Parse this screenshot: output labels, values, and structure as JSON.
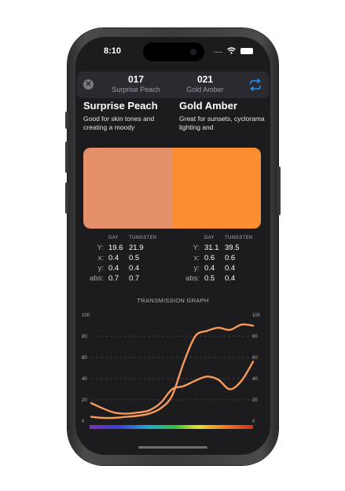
{
  "status_bar": {
    "time": "8:10",
    "dots": "....",
    "wifi_icon": "wifi-icon",
    "battery_icon": "battery-icon"
  },
  "header": {
    "close_icon": "close-icon",
    "swap_icon": "swap-arrows-icon",
    "left": {
      "number": "017",
      "name": "Surprise Peach"
    },
    "right": {
      "number": "021",
      "name": "Gold Amber"
    }
  },
  "filters": [
    {
      "title": "Surprise Peach",
      "description": "Good for skin tones and creating a moody",
      "color": "#e68f6b"
    },
    {
      "title": "Gold Amber",
      "description": "Great for sunsets, cyclorama lighting and",
      "color": "#fb8d33"
    }
  ],
  "stats": {
    "col_headers": [
      "DAY",
      "TUNGSTEN"
    ],
    "row_labels": [
      "Y:",
      "x:",
      "y:",
      "abs:"
    ],
    "left": [
      [
        "19.6",
        "21.9"
      ],
      [
        "0.4",
        "0.5"
      ],
      [
        "0.4",
        "0.4"
      ],
      [
        "0.7",
        "0.7"
      ]
    ],
    "right": [
      [
        "31.1",
        "39.5"
      ],
      [
        "0.6",
        "0.6"
      ],
      [
        "0.4",
        "0.4"
      ],
      [
        "0.5",
        "0.4"
      ]
    ]
  },
  "graph": {
    "title": "TRANSMISSION GRAPH",
    "y_ticks": [
      "100",
      "80",
      "60",
      "40",
      "20",
      "0"
    ],
    "colors": {
      "line": "#f79a5a",
      "grid": "#48484e",
      "axis_text": "#b0b0b6"
    },
    "series": [
      {
        "filter": "Surprise Peach",
        "values": [
          17,
          12,
          8,
          7,
          8,
          10,
          17,
          30,
          33,
          38,
          42,
          39,
          30,
          38,
          56
        ]
      },
      {
        "filter": "Gold Amber",
        "values": [
          4,
          3,
          3,
          4,
          5,
          7,
          12,
          24,
          55,
          80,
          85,
          88,
          86,
          91,
          90
        ]
      }
    ]
  }
}
